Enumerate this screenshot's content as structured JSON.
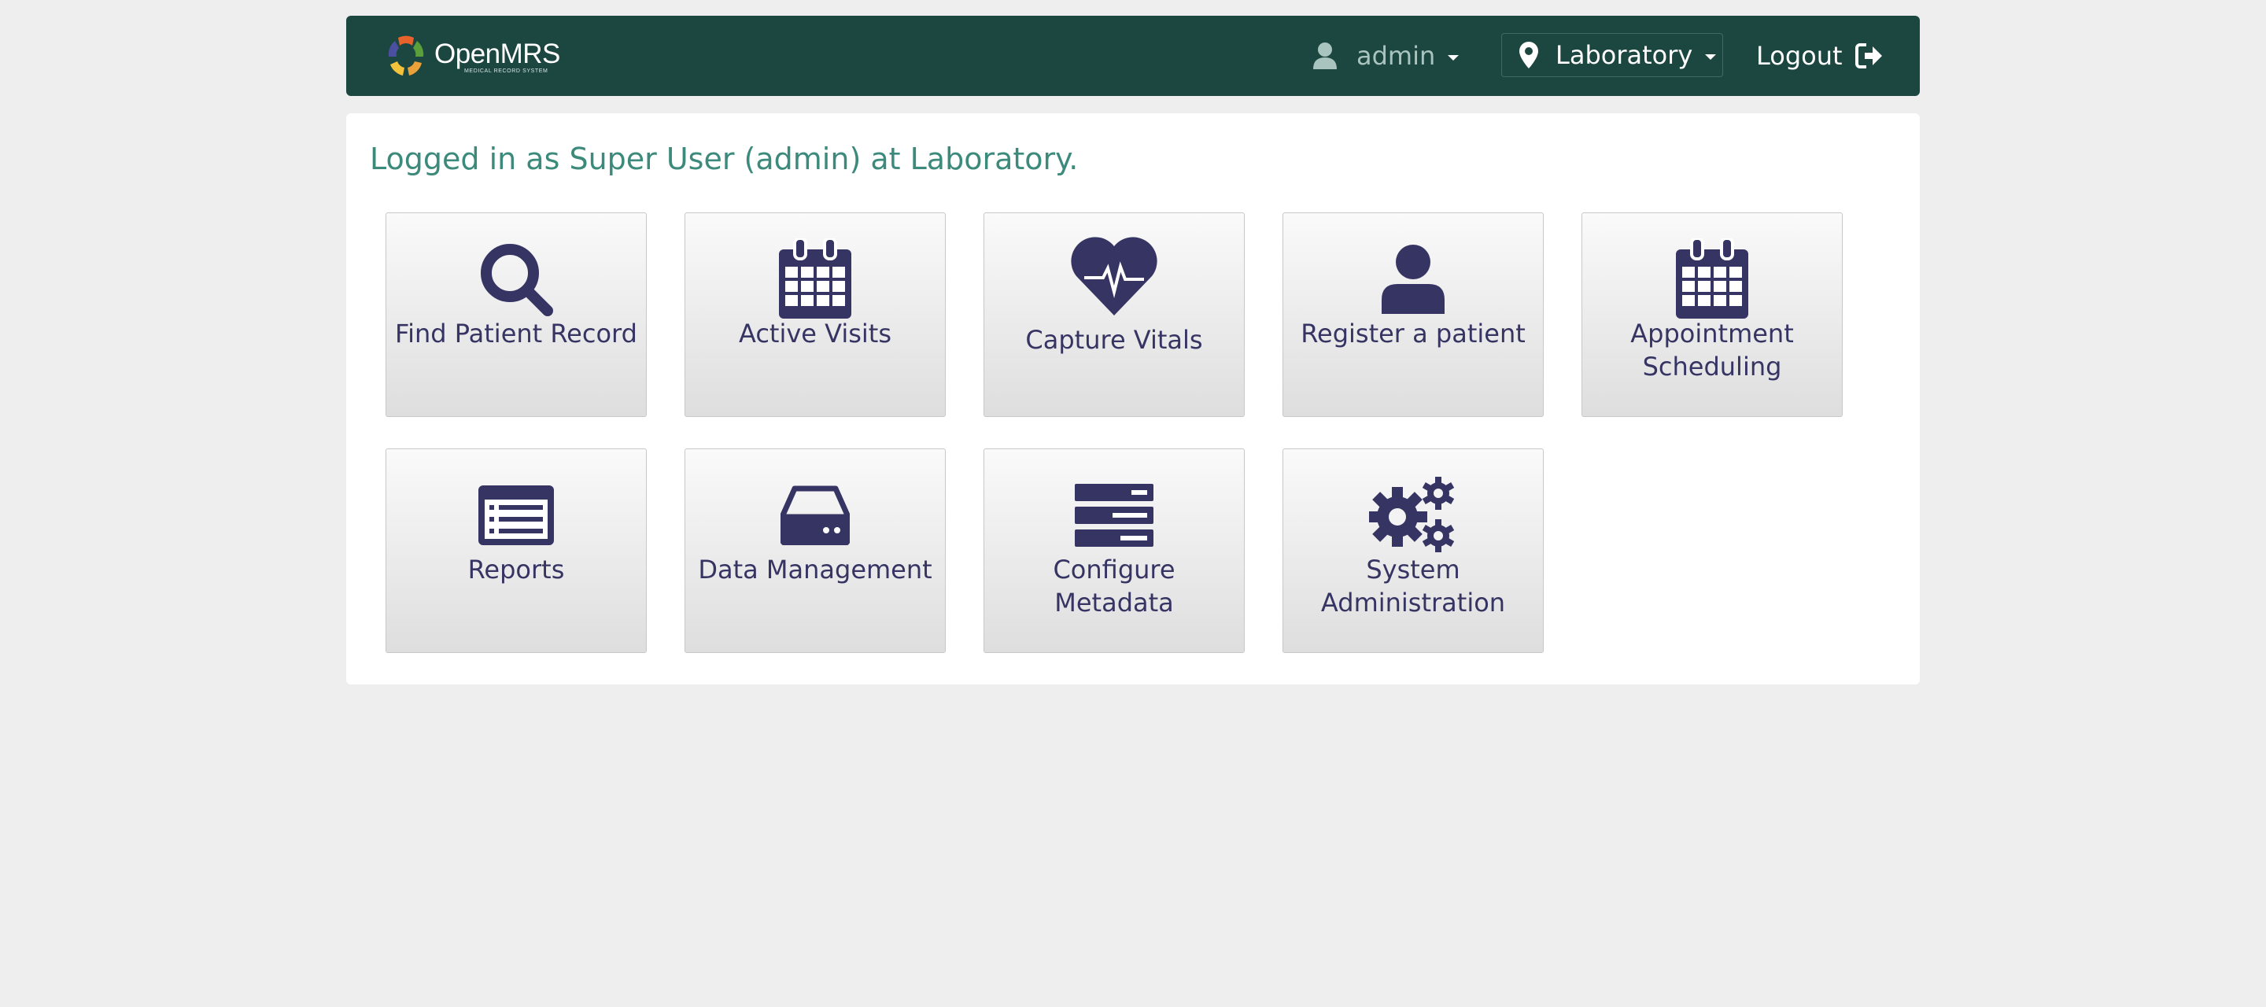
{
  "header": {
    "logo_name": "OpenMRS",
    "logo_tagline": "MEDICAL RECORD SYSTEM",
    "user": {
      "label": "admin",
      "icon": "user-icon"
    },
    "location": {
      "label": "Laboratory",
      "icon": "map-marker-icon"
    },
    "logout": {
      "label": "Logout",
      "icon": "sign-out-icon"
    }
  },
  "main": {
    "welcome": "Logged in as Super User (admin) at Laboratory.",
    "apps": [
      {
        "label": "Find Patient Record",
        "icon": "search-icon"
      },
      {
        "label": "Active Visits",
        "icon": "calendar-icon"
      },
      {
        "label": "Capture Vitals",
        "icon": "heartbeat-icon"
      },
      {
        "label": "Register a patient",
        "icon": "user-icon"
      },
      {
        "label": "Appointment Scheduling",
        "icon": "calendar-icon"
      },
      {
        "label": "Reports",
        "icon": "list-alt-icon"
      },
      {
        "label": "Data Management",
        "icon": "hdd-icon"
      },
      {
        "label": "Configure Metadata",
        "icon": "tasks-icon"
      },
      {
        "label": "System Administration",
        "icon": "gears-icon"
      }
    ]
  },
  "colors": {
    "header_bg": "#1c4640",
    "welcome_text": "#3c8a7b",
    "tile_text": "#363463",
    "icon": "#363463",
    "page_bg": "#eeeeee"
  }
}
